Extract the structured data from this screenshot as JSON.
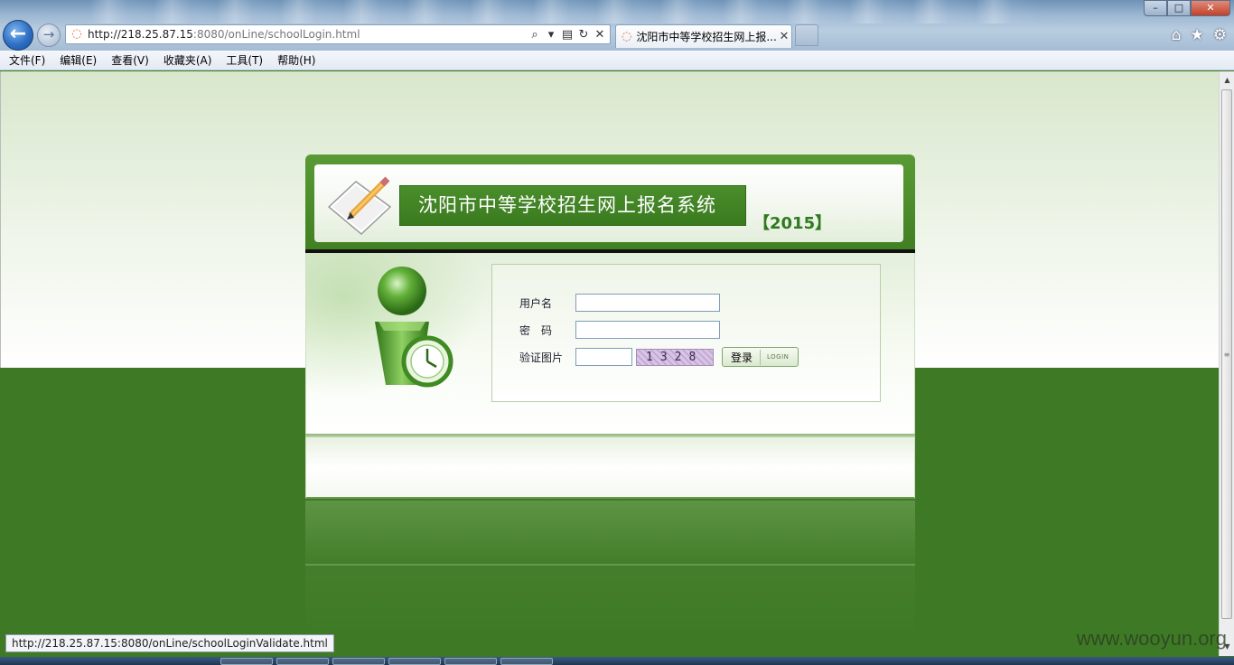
{
  "browser": {
    "url_host": "http://218.25.87.15",
    "url_rest": ":8080/onLine/schoolLogin.html",
    "tab_title": "沈阳市中等学校招生网上报...",
    "tab_close": "✕",
    "status_url": "http://218.25.87.15:8080/onLine/schoolLoginValidate.html"
  },
  "menu": [
    "文件(F)",
    "编辑(E)",
    "查看(V)",
    "收藏夹(A)",
    "工具(T)",
    "帮助(H)"
  ],
  "header": {
    "title": "沈阳市中等学校招生网上报名系统",
    "year": "【2015】"
  },
  "form": {
    "username_label": "用户名",
    "password_label": "密　码",
    "captcha_label": "验证图片",
    "captcha_text": "1328",
    "login_cn": "登录",
    "login_en": "LOGIN"
  },
  "watermark": "www.wooyun.org",
  "colors": {
    "brand_green": "#3e7a25",
    "title_green": "#3a7a1f",
    "year_green": "#2f7a1f"
  }
}
